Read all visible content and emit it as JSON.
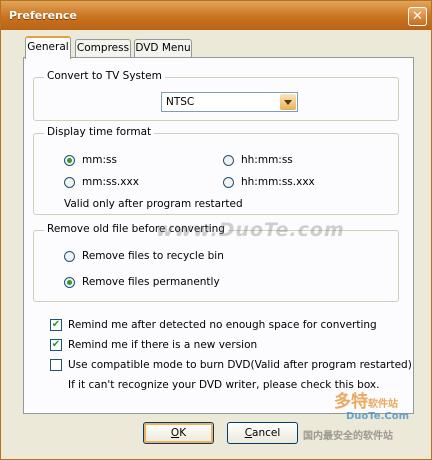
{
  "window": {
    "title": "Preference"
  },
  "tabs": [
    {
      "label": "General",
      "active": true
    },
    {
      "label": "Compress",
      "active": false
    },
    {
      "label": "DVD Menu",
      "active": false
    }
  ],
  "tv_system": {
    "legend": "Convert to TV System",
    "selected": "NTSC"
  },
  "time_format": {
    "legend": "Display time format",
    "options": [
      {
        "label": "mm:ss",
        "checked": true
      },
      {
        "label": "hh:mm:ss",
        "checked": false
      },
      {
        "label": "mm:ss.xxx",
        "checked": false
      },
      {
        "label": "hh:mm:ss.xxx",
        "checked": false
      }
    ],
    "note": "Valid only after program restarted"
  },
  "remove_old": {
    "legend": "Remove old file before converting",
    "options": [
      {
        "label": "Remove files to recycle bin",
        "checked": false
      },
      {
        "label": "Remove files permanently",
        "checked": true
      }
    ]
  },
  "checks": [
    {
      "label": "Remind me after detected no enough space for converting",
      "checked": true
    },
    {
      "label": "Remind me if there is a new version",
      "checked": true
    },
    {
      "label": "Use compatible mode to burn DVD(Valid after program restarted)",
      "checked": false
    }
  ],
  "dvd_note": "If it can't recognize your DVD writer, please check this box.",
  "buttons": {
    "ok": {
      "accel": "O",
      "rest": "K"
    },
    "cancel": {
      "accel": "C",
      "rest": "ancel"
    }
  },
  "watermark": {
    "main": "www.DuoTe.com",
    "brand": "多特",
    "brand_suffix": "软件站",
    "small": "DuoTe.Com",
    "tagline": "国内最安全的软件站"
  },
  "colors": {
    "title_bar": "#c9721f",
    "dialog_bg": "#ece9d8",
    "tab_accent": "#e5a23a",
    "check_mark": "#21a121"
  }
}
